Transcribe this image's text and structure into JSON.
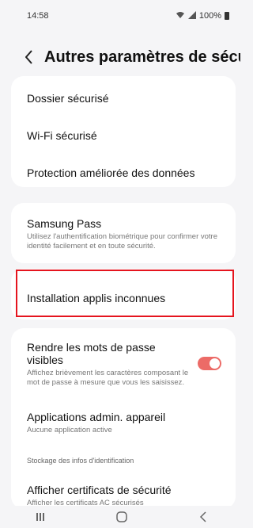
{
  "status_bar": {
    "time": "14:58",
    "battery_text": "100%"
  },
  "header": {
    "title": "Autres paramètres de sécu..."
  },
  "group1": [
    {
      "title": "Dossier sécurisé"
    },
    {
      "title": "Wi-Fi sécurisé"
    },
    {
      "title": "Protection améliorée des données"
    }
  ],
  "samsung_pass": {
    "title": "Samsung Pass",
    "subtitle": "Utilisez l'authentification biométrique pour confirmer votre identité facilement et en toute sécurité."
  },
  "unknown_apps": {
    "title": "Installation applis inconnues"
  },
  "visible_passwords": {
    "title": "Rendre les mots de passe visibles",
    "subtitle": "Affichez brièvement les caractères composant le mot de passe à mesure que vous les saisissez.",
    "toggle_on": true
  },
  "device_admin": {
    "title": "Applications admin. appareil",
    "subtitle": "Aucune application active"
  },
  "credentials_section": {
    "header": "Stockage des infos d'identification",
    "item_title": "Afficher certificats de sécurité",
    "item_subtitle_partial": "Afficher les certificats AC sécurisés"
  },
  "colors": {
    "accent": "#ec6b67",
    "highlight_border": "#e5141e",
    "background": "#f5f5f7"
  },
  "icons": {
    "back": "chevron-left-icon",
    "nav_recent": "recent-apps-icon",
    "nav_home": "home-icon",
    "nav_back": "back-icon"
  }
}
